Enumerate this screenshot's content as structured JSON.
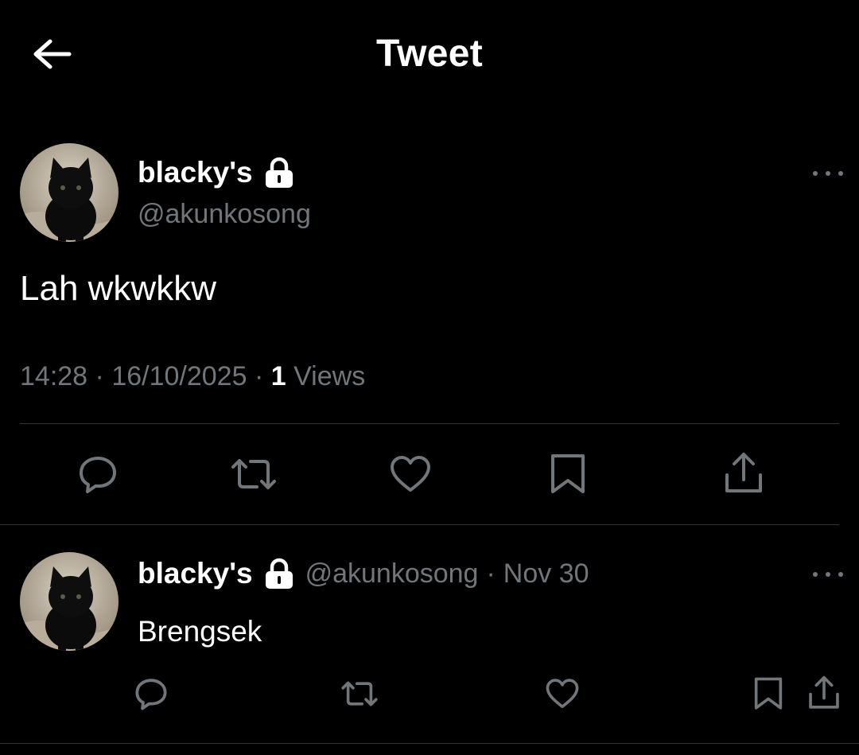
{
  "header": {
    "back_icon": "arrow-left-icon",
    "title": "Tweet"
  },
  "main_tweet": {
    "display_name": "blacky's",
    "lock_icon": "lock-icon",
    "handle": "@akunkosong",
    "text": "Lah wkwkkw",
    "time": "14:28",
    "separator": "·",
    "date": "16/10/2025",
    "views_count": "1",
    "views_label": "Views",
    "actions": [
      "reply-icon",
      "retweet-icon",
      "like-icon",
      "bookmark-icon",
      "share-icon"
    ]
  },
  "reply_tweet": {
    "display_name": "blacky's",
    "handle": "@akunkosong",
    "separator": "·",
    "date": "Nov 30",
    "text": "Brengsek",
    "actions": [
      "reply-icon",
      "retweet-icon",
      "like-icon",
      "bookmark-icon",
      "share-icon"
    ]
  },
  "colors": {
    "background": "#000000",
    "primary_text": "#ffffff",
    "secondary_text": "#71767b",
    "divider": "#2f3336"
  }
}
